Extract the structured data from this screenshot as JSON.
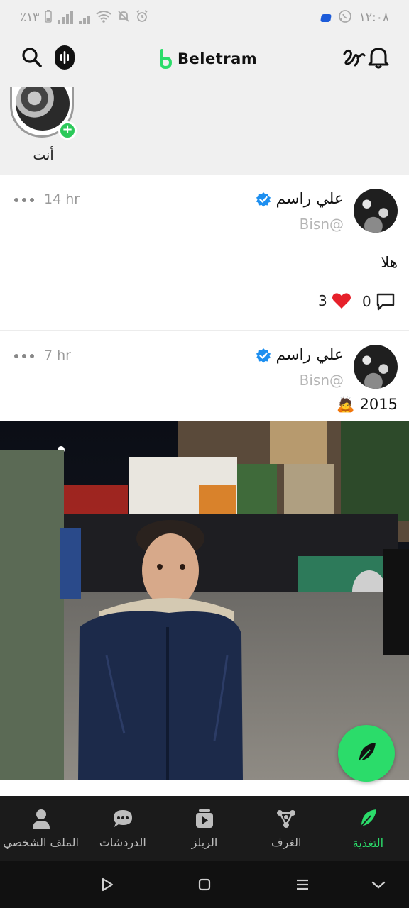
{
  "status_bar": {
    "left_text": "٪١٣",
    "time": "١٢:٠٨",
    "icons": [
      "battery-icon",
      "signal-icon",
      "signal-icon",
      "sim-icon",
      "wifi-icon",
      "mute-icon",
      "alarm-icon",
      "chip-icon",
      "whatsapp-icon"
    ]
  },
  "app": {
    "name": "Beletram",
    "accent_color": "#2bdc6a"
  },
  "stories": {
    "self_label": "أنت"
  },
  "posts": [
    {
      "author_name": "علي راسم",
      "handle": "Bisn@",
      "time": "14 hr",
      "text": "هلا",
      "comments": "0",
      "likes": "3",
      "has_media": false
    },
    {
      "author_name": "علي راسم",
      "handle": "Bisn@",
      "time": "7 hr",
      "text": "2015 🙇",
      "has_media": true
    }
  ],
  "bottom_nav": {
    "items": [
      {
        "label": "الملف الشخصي",
        "icon": "profile-icon"
      },
      {
        "label": "الدردشات",
        "icon": "chats-icon"
      },
      {
        "label": "الريلز",
        "icon": "reels-icon"
      },
      {
        "label": "الغرف",
        "icon": "rooms-icon"
      },
      {
        "label": "التغذية",
        "icon": "feed-icon",
        "active": true
      }
    ]
  }
}
